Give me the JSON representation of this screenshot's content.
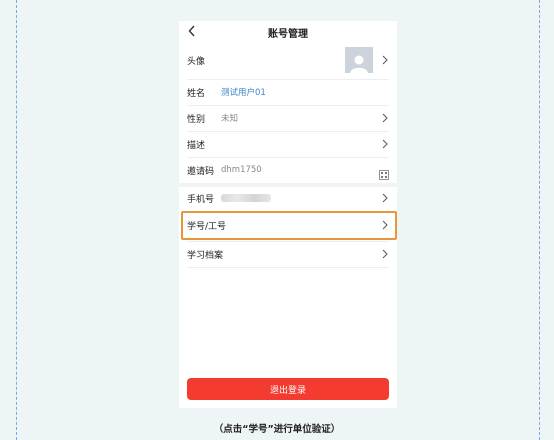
{
  "header": {
    "title": "账号管理"
  },
  "rows": {
    "avatar": {
      "label": "头像"
    },
    "name": {
      "label": "姓名",
      "value": "测试用户01"
    },
    "gender": {
      "label": "性别",
      "value": "未知"
    },
    "desc": {
      "label": "描述"
    },
    "invite": {
      "label": "邀请码",
      "value": "dhm1750"
    },
    "phone": {
      "label": "手机号"
    },
    "student_id": {
      "label": "学号/工号"
    },
    "archive": {
      "label": "学习档案"
    }
  },
  "logout_label": "退出登录",
  "caption": "（点击“学号”进行单位验证）",
  "colors": {
    "accent_link": "#3a86c8",
    "logout": "#f43b30",
    "highlight": "#e8963e"
  }
}
